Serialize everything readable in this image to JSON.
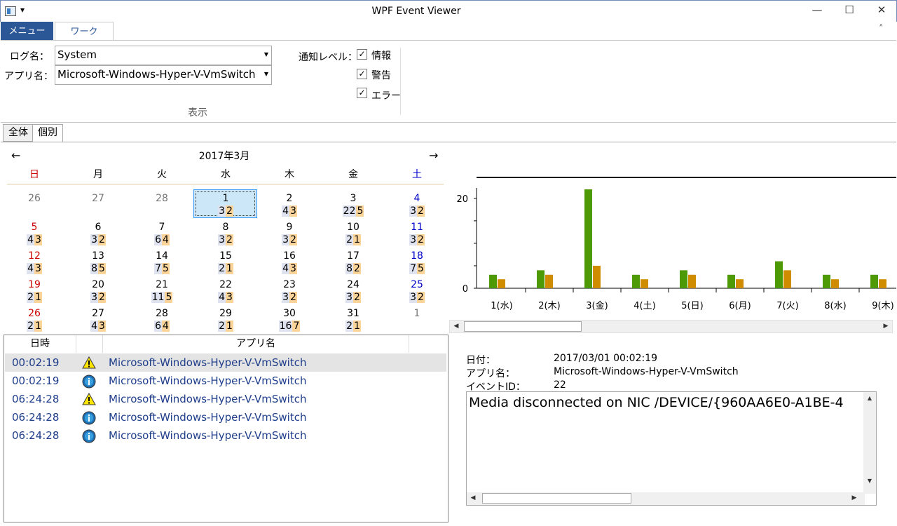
{
  "window": {
    "title": "WPF Event Viewer",
    "qat": "▾",
    "minimize": "—",
    "maximize": "☐",
    "close": "✕"
  },
  "ribbon": {
    "tabs": [
      {
        "label": "メニュー"
      },
      {
        "label": "ワーク"
      }
    ],
    "collapse": "˄",
    "log_name_label": "ログ名：",
    "log_name_value": "System",
    "app_name_label": "アプリ名：",
    "app_name_value": "Microsoft-Windows-Hyper-V-VmSwitch",
    "level_label": "通知レベル：",
    "levels": [
      {
        "label": "情報",
        "checked": true
      },
      {
        "label": "警告",
        "checked": true
      },
      {
        "label": "エラー",
        "checked": true
      }
    ],
    "check_mark": "✓",
    "group_label": "表示"
  },
  "content_tabs": [
    {
      "label": "全体"
    },
    {
      "label": "個別"
    }
  ],
  "calendar": {
    "title": "2017年3月",
    "prev": "←",
    "next": "→",
    "weekdays": [
      "日",
      "月",
      "火",
      "水",
      "木",
      "金",
      "土"
    ],
    "weeks": [
      [
        {
          "d": "26",
          "other": true
        },
        {
          "d": "27",
          "other": true
        },
        {
          "d": "28",
          "other": true
        },
        {
          "d": "1",
          "g": "3",
          "o": "2",
          "sel": true
        },
        {
          "d": "2",
          "g": "4",
          "o": "3"
        },
        {
          "d": "3",
          "g": "22",
          "o": "5"
        },
        {
          "d": "4",
          "g": "3",
          "o": "2"
        }
      ],
      [
        {
          "d": "5",
          "g": "4",
          "o": "3"
        },
        {
          "d": "6",
          "g": "3",
          "o": "2"
        },
        {
          "d": "7",
          "g": "6",
          "o": "4"
        },
        {
          "d": "8",
          "g": "3",
          "o": "2"
        },
        {
          "d": "9",
          "g": "3",
          "o": "2"
        },
        {
          "d": "10",
          "g": "2",
          "o": "1"
        },
        {
          "d": "11",
          "g": "3",
          "o": "2"
        }
      ],
      [
        {
          "d": "12",
          "g": "4",
          "o": "3"
        },
        {
          "d": "13",
          "g": "8",
          "o": "5"
        },
        {
          "d": "14",
          "g": "7",
          "o": "5"
        },
        {
          "d": "15",
          "g": "2",
          "o": "1"
        },
        {
          "d": "16",
          "g": "4",
          "o": "3"
        },
        {
          "d": "17",
          "g": "8",
          "o": "2"
        },
        {
          "d": "18",
          "g": "7",
          "o": "5"
        }
      ],
      [
        {
          "d": "19",
          "g": "2",
          "o": "1"
        },
        {
          "d": "20",
          "g": "3",
          "o": "2"
        },
        {
          "d": "21",
          "g": "11",
          "o": "5"
        },
        {
          "d": "22",
          "g": "4",
          "o": "3"
        },
        {
          "d": "23",
          "g": "3",
          "o": "2"
        },
        {
          "d": "24",
          "g": "3",
          "o": "2"
        },
        {
          "d": "25",
          "g": "3",
          "o": "2"
        }
      ],
      [
        {
          "d": "26",
          "g": "2",
          "o": "1"
        },
        {
          "d": "27",
          "g": "4",
          "o": "3"
        },
        {
          "d": "28",
          "g": "6",
          "o": "4"
        },
        {
          "d": "29",
          "g": "2",
          "o": "1"
        },
        {
          "d": "30",
          "g": "16",
          "o": "7"
        },
        {
          "d": "31",
          "g": "2",
          "o": "1"
        },
        {
          "d": "1",
          "other": true
        }
      ]
    ]
  },
  "list": {
    "headers": [
      "日時",
      "",
      "アプリ名"
    ],
    "rows": [
      {
        "time": "00:02:19",
        "level": "warning",
        "app": "Microsoft-Windows-Hyper-V-VmSwitch",
        "selected": true
      },
      {
        "time": "00:02:19",
        "level": "info",
        "app": "Microsoft-Windows-Hyper-V-VmSwitch"
      },
      {
        "time": "06:24:28",
        "level": "warning",
        "app": "Microsoft-Windows-Hyper-V-VmSwitch"
      },
      {
        "time": "06:24:28",
        "level": "info",
        "app": "Microsoft-Windows-Hyper-V-VmSwitch"
      },
      {
        "time": "06:24:28",
        "level": "info",
        "app": "Microsoft-Windows-Hyper-V-VmSwitch"
      }
    ]
  },
  "chart_data": {
    "type": "bar",
    "categories": [
      "1(水)",
      "2(木)",
      "3(金)",
      "4(土)",
      "5(日)",
      "6(月)",
      "7(火)",
      "8(水)",
      "9(木)"
    ],
    "series": [
      {
        "values": [
          3,
          4,
          22,
          3,
          4,
          3,
          6,
          3,
          3
        ],
        "color": "#4e9a06"
      },
      {
        "values": [
          2,
          3,
          5,
          2,
          3,
          2,
          4,
          2,
          2
        ],
        "color": "#d08c00"
      }
    ],
    "yticks": [
      "0",
      "20"
    ],
    "ylim": [
      0,
      22
    ],
    "grid": false
  },
  "scroll_arrows": {
    "left": "◀",
    "right": "▶",
    "up": "▲",
    "down": "▼"
  },
  "details": {
    "date_label": "日付：",
    "date_value": "2017/03/01 00:02:19",
    "app_label": "アプリ名：",
    "app_value": "Microsoft-Windows-Hyper-V-VmSwitch",
    "event_label": "イベントID：",
    "event_value": "22",
    "message": "Media disconnected on NIC /DEVICE/{960AA6E0-A1BE-4"
  }
}
